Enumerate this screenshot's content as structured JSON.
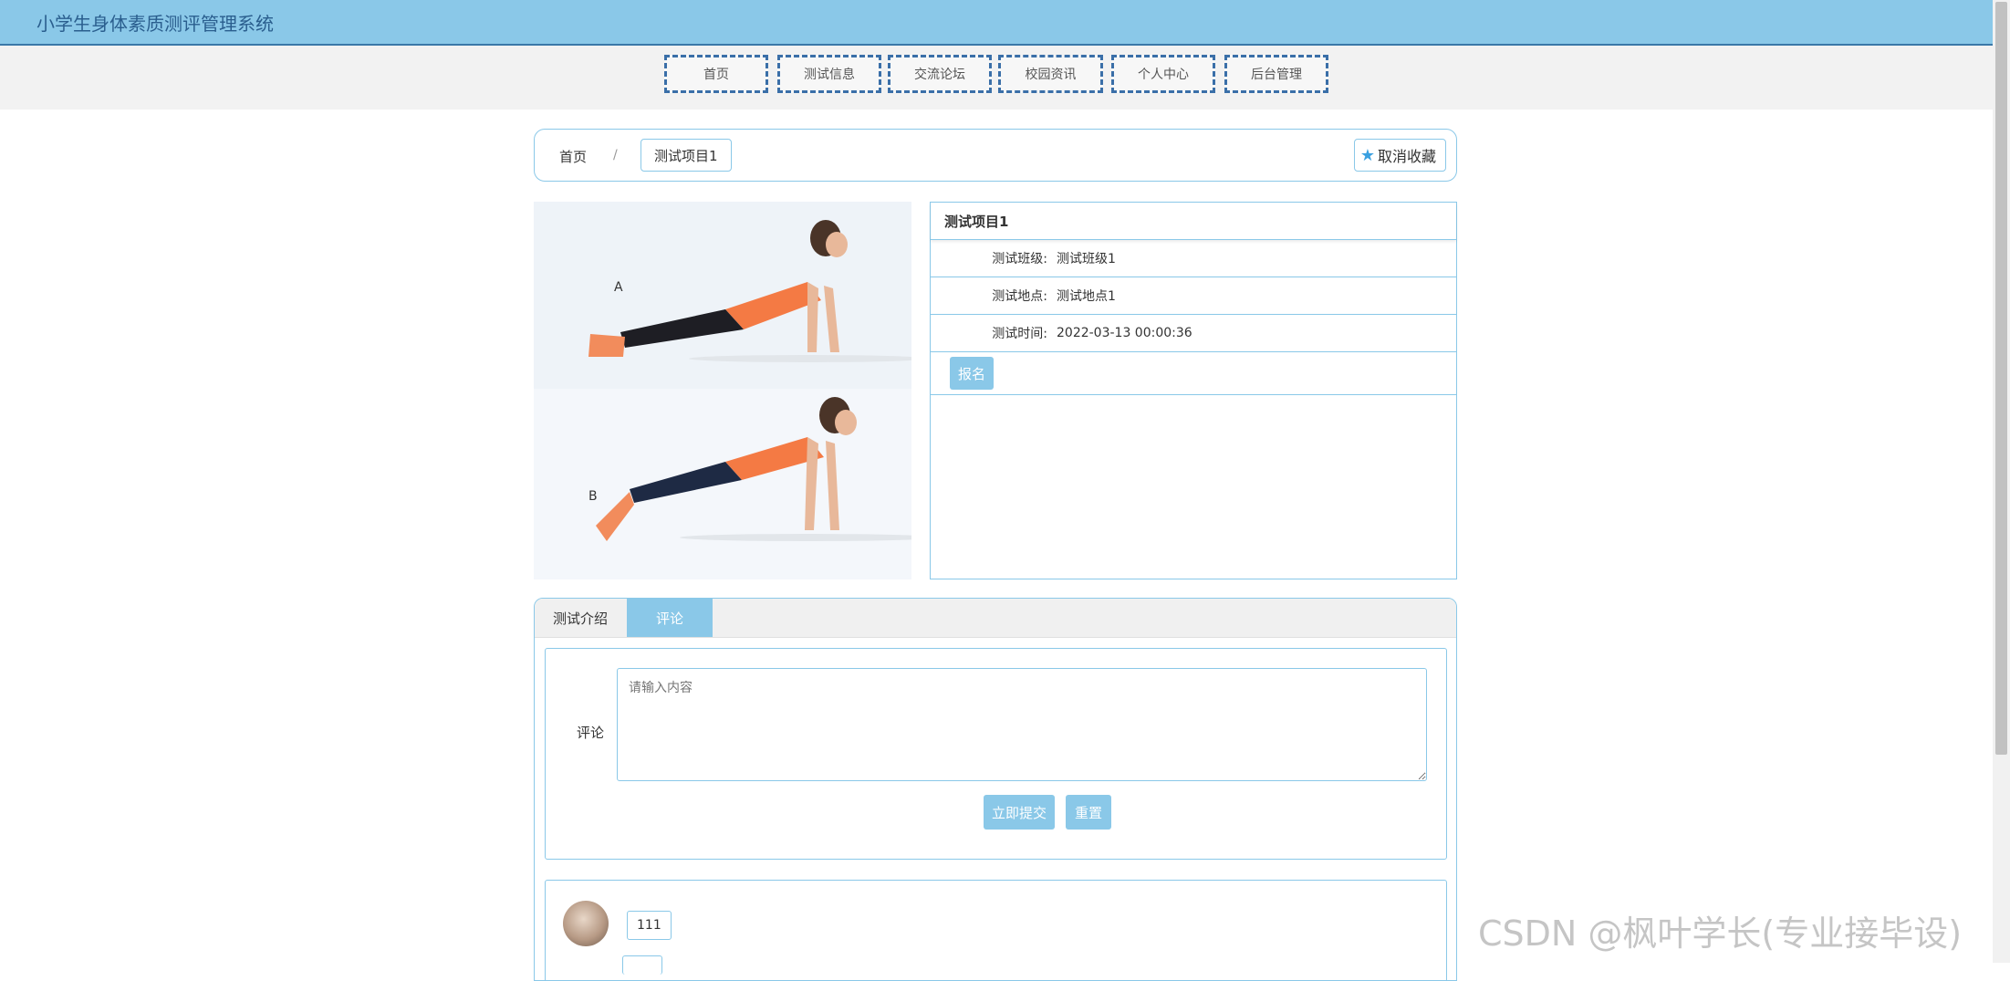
{
  "header": {
    "title": "小学生身体素质测评管理系统"
  },
  "nav": {
    "items": [
      "首页",
      "测试信息",
      "交流论坛",
      "校园资讯",
      "个人中心",
      "后台管理"
    ]
  },
  "breadcrumb": {
    "home": "首页",
    "separator": "/",
    "current": "测试项目1"
  },
  "favorite": {
    "icon": "star-icon",
    "label": "取消收藏"
  },
  "detail": {
    "title": "测试项目1",
    "rows": [
      {
        "label": "测试班级:",
        "value": "测试班级1"
      },
      {
        "label": "测试地点:",
        "value": "测试地点1"
      },
      {
        "label": "测试时间:",
        "value": "2022-03-13 00:00:36"
      }
    ],
    "signup_label": "报名"
  },
  "photo": {
    "panel_a_label": "A",
    "panel_b_label": "B"
  },
  "tabs": {
    "intro": "测试介绍",
    "comment": "评论",
    "active": "评论"
  },
  "comment_form": {
    "label": "评论",
    "placeholder": "请输入内容",
    "submit_label": "立即提交",
    "reset_label": "重置"
  },
  "comments": [
    {
      "text": "111"
    }
  ],
  "watermark": "CSDN @枫叶学长(专业接毕设)",
  "colors": {
    "accent": "#8ac8e8",
    "nav_border": "#3a6fa8",
    "header_text": "#2a5e8e"
  }
}
